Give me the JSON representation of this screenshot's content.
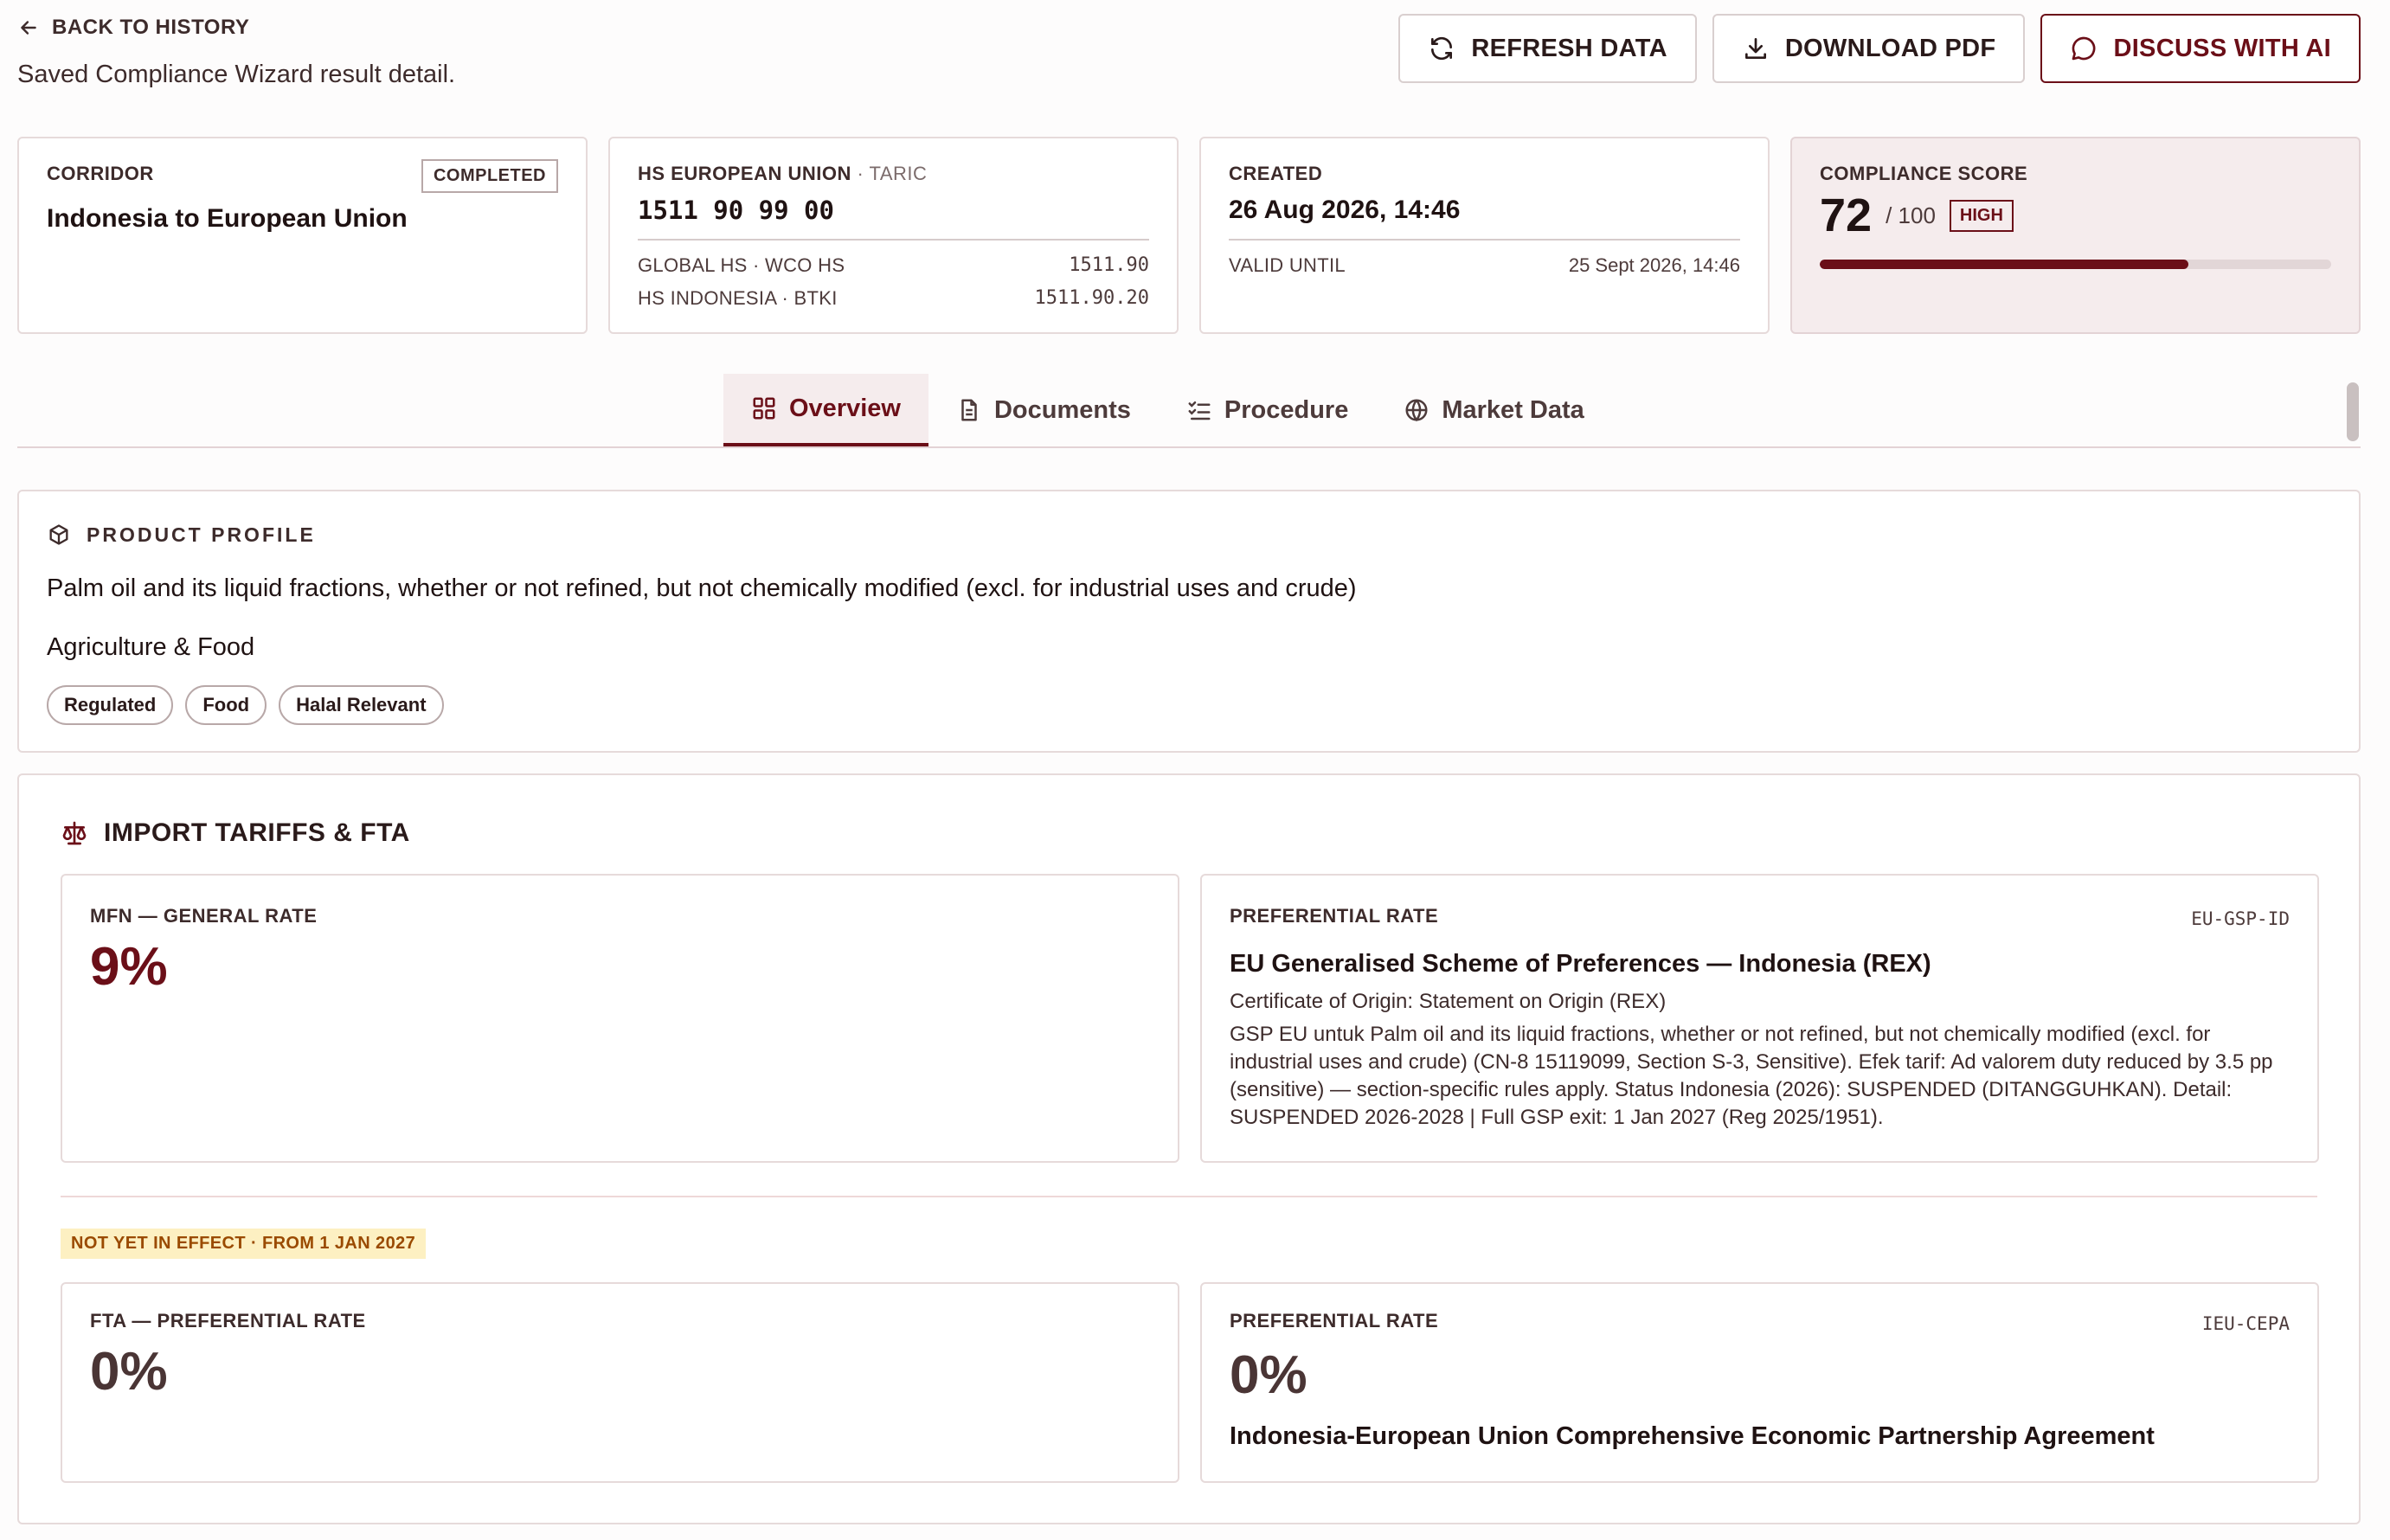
{
  "header": {
    "back_label": "BACK TO HISTORY",
    "subtitle": "Saved Compliance Wizard result detail.",
    "refresh_label": "REFRESH DATA",
    "download_label": "DOWNLOAD PDF",
    "discuss_label": "DISCUSS WITH AI"
  },
  "summary": {
    "corridor": {
      "label": "CORRIDOR",
      "status": "COMPLETED",
      "value": "Indonesia to European Union"
    },
    "hs": {
      "label": "HS EUROPEAN UNION",
      "label_suffix": "· TARIC",
      "code": "1511 90 99 00",
      "rows": [
        {
          "key": "GLOBAL HS · WCO HS",
          "value": "1511.90"
        },
        {
          "key": "HS INDONESIA · BTKI",
          "value": "1511.90.20"
        }
      ]
    },
    "created": {
      "label": "CREATED",
      "value": "26 Aug 2026, 14:46",
      "valid_label": "VALID UNTIL",
      "valid_value": "25 Sept 2026, 14:46"
    },
    "score": {
      "label": "COMPLIANCE SCORE",
      "value": "72",
      "max": "/ 100",
      "level": "HIGH",
      "fraction": 0.72
    }
  },
  "tabs": [
    {
      "label": "Overview",
      "icon": "grid-icon"
    },
    {
      "label": "Documents",
      "icon": "document-icon"
    },
    {
      "label": "Procedure",
      "icon": "checklist-icon"
    },
    {
      "label": "Market Data",
      "icon": "globe-icon"
    }
  ],
  "product_profile": {
    "title": "PRODUCT PROFILE",
    "description": "Palm oil and its liquid fractions, whether or not refined, but not chemically modified (excl. for industrial uses and crude)",
    "category": "Agriculture & Food",
    "tags": [
      "Regulated",
      "Food",
      "Halal Relevant"
    ]
  },
  "tariffs": {
    "title": "IMPORT TARIFFS & FTA",
    "mfn": {
      "label": "MFN — GENERAL RATE",
      "rate": "9%"
    },
    "gsp": {
      "label": "PREFERENTIAL RATE",
      "code": "EU-GSP-ID",
      "name": "EU Generalised Scheme of Preferences — Indonesia (REX)",
      "origin": "Certificate of Origin: Statement on Origin (REX)",
      "detail": "GSP EU untuk Palm oil and its liquid fractions, whether or not refined, but not chemically modified (excl. for industrial uses and crude) (CN-8 15119099, Section S-3, Sensitive). Efek tarif: Ad valorem duty reduced by 3.5 pp (sensitive) — section-specific rules apply. Status Indonesia (2026): SUSPENDED (DITANGGUHKAN). Detail: SUSPENDED 2026-2028 | Full GSP exit: 1 Jan 2027 (Reg 2025/1951)."
    },
    "notice": "NOT YET IN EFFECT · FROM 1 JAN 2027",
    "fta": {
      "label": "FTA — PREFERENTIAL RATE",
      "rate": "0%"
    },
    "cepa": {
      "label": "PREFERENTIAL RATE",
      "code": "IEU-CEPA",
      "rate": "0%",
      "name": "Indonesia-European Union Comprehensive Economic Partnership Agreement"
    }
  },
  "colors": {
    "accent": "#6b0f18",
    "warn_bg": "#fdf0c2",
    "warn_text": "#9a4a00"
  }
}
